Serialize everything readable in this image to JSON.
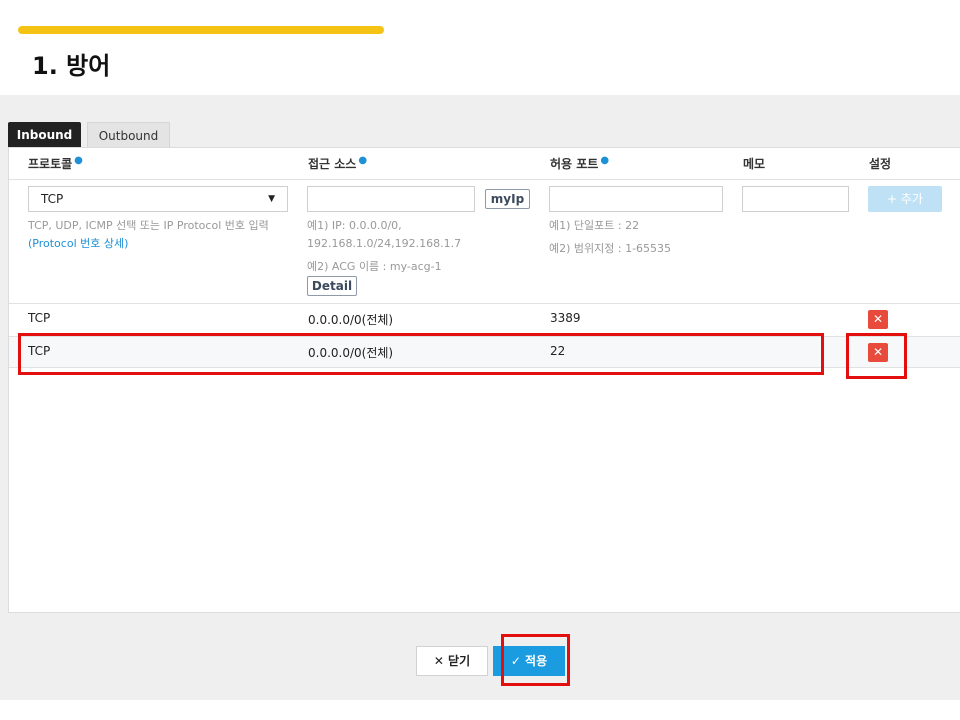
{
  "slide": {
    "title": "1. 방어"
  },
  "tabs": [
    {
      "label": "Inbound",
      "active": true
    },
    {
      "label": "Outbound",
      "active": false
    }
  ],
  "columns": {
    "protocol": "프로토콜",
    "source": "접근 소스",
    "port": "허용 포트",
    "memo": "메모",
    "settings": "설정"
  },
  "form": {
    "protocol_value": "TCP",
    "protocol_hint": "TCP, UDP, ICMP 선택 또는 IP Protocol 번호 입력",
    "protocol_link": "(Protocol 번호 상세)",
    "myip_label": "myIp",
    "add_label": "+ 추가",
    "source_hint1": "예1) IP: 0.0.0.0/0,",
    "source_hint2": "192.168.1.0/24,192.168.1.7",
    "source_hint3": "예2) ACG 이름 : my-acg-1",
    "detail_label": "Detail",
    "port_hint1": "예1) 단일포트 : 22",
    "port_hint2": "예2) 범위지정 : 1-65535"
  },
  "rules": [
    {
      "protocol": "TCP",
      "source": "0.0.0.0/0(전체)",
      "port": "3389"
    },
    {
      "protocol": "TCP",
      "source": "0.0.0.0/0(전체)",
      "port": "22"
    }
  ],
  "footer": {
    "close_label": "✕ 닫기",
    "apply_label": "✓ 적용"
  },
  "colors": {
    "accent_bar": "#f5c314",
    "highlight": "#e30f0f",
    "apply": "#1c9ce0",
    "delete": "#e84a3c",
    "required_dot": "#1e90d6"
  }
}
